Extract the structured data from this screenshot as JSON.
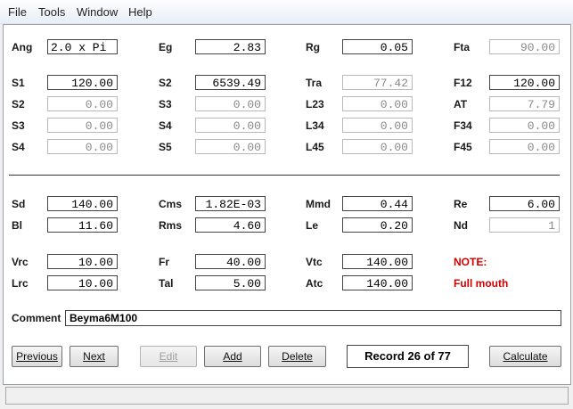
{
  "menu": [
    "File",
    "Tools",
    "Window",
    "Help"
  ],
  "fields": {
    "ang": {
      "label": "Ang",
      "value": "2.0 x Pi"
    },
    "eg": {
      "label": "Eg",
      "value": "2.83"
    },
    "rg": {
      "label": "Rg",
      "value": "0.05"
    },
    "fta": {
      "label": "Fta",
      "value": "90.00"
    },
    "s1": {
      "label": "S1",
      "value": "120.00"
    },
    "s2a": {
      "label": "S2",
      "value": "6539.49"
    },
    "tra": {
      "label": "Tra",
      "value": "77.42"
    },
    "f12": {
      "label": "F12",
      "value": "120.00"
    },
    "s2b": {
      "label": "S2",
      "value": "0.00"
    },
    "s3a": {
      "label": "S3",
      "value": "0.00"
    },
    "l23": {
      "label": "L23",
      "value": "0.00"
    },
    "at": {
      "label": "AT",
      "value": "7.79"
    },
    "s3b": {
      "label": "S3",
      "value": "0.00"
    },
    "s4a": {
      "label": "S4",
      "value": "0.00"
    },
    "l34": {
      "label": "L34",
      "value": "0.00"
    },
    "f34": {
      "label": "F34",
      "value": "0.00"
    },
    "s4b": {
      "label": "S4",
      "value": "0.00"
    },
    "s5": {
      "label": "S5",
      "value": "0.00"
    },
    "l45": {
      "label": "L45",
      "value": "0.00"
    },
    "f45": {
      "label": "F45",
      "value": "0.00"
    },
    "sd": {
      "label": "Sd",
      "value": "140.00"
    },
    "cms": {
      "label": "Cms",
      "value": "1.82E-03"
    },
    "mmd": {
      "label": "Mmd",
      "value": "0.44"
    },
    "re": {
      "label": "Re",
      "value": "6.00"
    },
    "bl": {
      "label": "Bl",
      "value": "11.60"
    },
    "rms": {
      "label": "Rms",
      "value": "4.60"
    },
    "le": {
      "label": "Le",
      "value": "0.20"
    },
    "nd": {
      "label": "Nd",
      "value": "1"
    },
    "vrc": {
      "label": "Vrc",
      "value": "10.00"
    },
    "fr": {
      "label": "Fr",
      "value": "40.00"
    },
    "vtc": {
      "label": "Vtc",
      "value": "140.00"
    },
    "lrc": {
      "label": "Lrc",
      "value": "10.00"
    },
    "tal": {
      "label": "Tal",
      "value": "5.00"
    },
    "atc": {
      "label": "Atc",
      "value": "140.00"
    }
  },
  "note": {
    "title": "NOTE:",
    "text": "Full mouth"
  },
  "comment": {
    "label": "Comment",
    "value": "Beyma6M100"
  },
  "buttons": {
    "previous": "Previous",
    "next": "Next",
    "edit": "Edit",
    "add": "Add",
    "delete": "Delete",
    "calculate": "Calculate"
  },
  "record": "Record 26 of 77",
  "colors": {
    "note": "#d40000",
    "window_bg": "#f0f0f0",
    "panel_bg": "#ffffff"
  }
}
